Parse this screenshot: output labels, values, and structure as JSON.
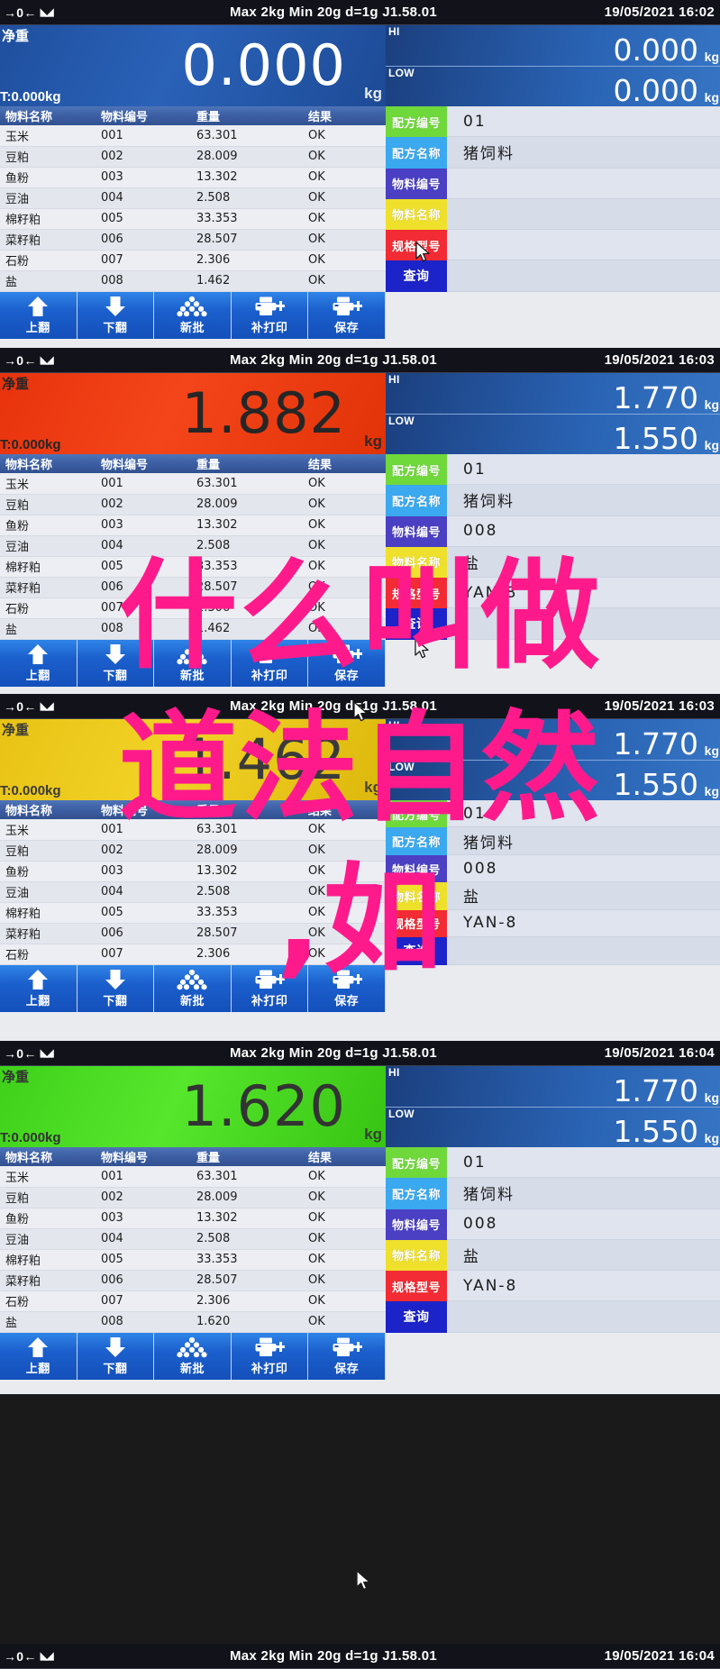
{
  "device": {
    "spec_line": "Max 2kg  Min 20g  d=1g    J1.58.01",
    "zero_icon": "→0←",
    "stable_icon": "stability-indicator",
    "net_label": "净重",
    "tare_label": "T:0.000kg",
    "unit": "kg",
    "hi_tag": "HI",
    "low_tag": "LOW"
  },
  "table": {
    "headers": {
      "name": "物料名称",
      "code": "物料编号",
      "weight": "重量",
      "result": "结果"
    }
  },
  "sidebar": {
    "tags": [
      {
        "label": "配方编号",
        "color": "#6fd83a"
      },
      {
        "label": "配方名称",
        "color": "#3ba9ef"
      },
      {
        "label": "物料编号",
        "color": "#4b3fc4"
      },
      {
        "label": "物料名称",
        "color": "#efe02c"
      },
      {
        "label": "规格型号",
        "color": "#f22b34"
      }
    ],
    "query_label": "查询"
  },
  "toolbar": {
    "buttons": [
      {
        "label": "上翻",
        "icon": "arrow-up-icon"
      },
      {
        "label": "下翻",
        "icon": "arrow-down-icon"
      },
      {
        "label": "新批",
        "icon": "pile-of-balls-icon"
      },
      {
        "label": "补打印",
        "icon": "printer-plus-icon"
      },
      {
        "label": "保存",
        "icon": "printer-save-icon"
      }
    ]
  },
  "panels": [
    {
      "id": "panel-1",
      "timestamp": "19/05/2021  16:02",
      "weight": "0.000",
      "weight_color": "blue",
      "hi": "0.000",
      "low": "0.000",
      "rows": [
        {
          "name": "玉米",
          "code": "001",
          "weight": "63.301",
          "result": "OK"
        },
        {
          "name": "豆粕",
          "code": "002",
          "weight": "28.009",
          "result": "OK"
        },
        {
          "name": "鱼粉",
          "code": "003",
          "weight": "13.302",
          "result": "OK"
        },
        {
          "name": "豆油",
          "code": "004",
          "weight": "2.508",
          "result": "OK"
        },
        {
          "name": "棉籽粕",
          "code": "005",
          "weight": "33.353",
          "result": "OK"
        },
        {
          "name": "菜籽粕",
          "code": "006",
          "weight": "28.507",
          "result": "OK"
        },
        {
          "name": "石粉",
          "code": "007",
          "weight": "2.306",
          "result": "OK"
        },
        {
          "name": "盐",
          "code": "008",
          "weight": "1.462",
          "result": "OK"
        }
      ],
      "values": [
        "01",
        "猪饲料",
        "",
        "",
        ""
      ]
    },
    {
      "id": "panel-2",
      "timestamp": "19/05/2021  16:03",
      "weight": "1.882",
      "weight_color": "red",
      "hi": "1.770",
      "low": "1.550",
      "rows": [
        {
          "name": "玉米",
          "code": "001",
          "weight": "63.301",
          "result": "OK"
        },
        {
          "name": "豆粕",
          "code": "002",
          "weight": "28.009",
          "result": "OK"
        },
        {
          "name": "鱼粉",
          "code": "003",
          "weight": "13.302",
          "result": "OK"
        },
        {
          "name": "豆油",
          "code": "004",
          "weight": "2.508",
          "result": "OK"
        },
        {
          "name": "棉籽粕",
          "code": "005",
          "weight": "33.353",
          "result": "OK"
        },
        {
          "name": "菜籽粕",
          "code": "006",
          "weight": "28.507",
          "result": "OK"
        },
        {
          "name": "石粉",
          "code": "007",
          "weight": "2.306",
          "result": "OK"
        },
        {
          "name": "盐",
          "code": "008",
          "weight": "1.462",
          "result": "OK"
        }
      ],
      "values": [
        "01",
        "猪饲料",
        "008",
        "盐",
        "YAN-8"
      ]
    },
    {
      "id": "panel-3",
      "timestamp": "19/05/2021  16:03",
      "weight": "1.462",
      "weight_color": "yellow",
      "hi": "1.770",
      "low": "1.550",
      "rows": [
        {
          "name": "玉米",
          "code": "001",
          "weight": "63.301",
          "result": "OK"
        },
        {
          "name": "豆粕",
          "code": "002",
          "weight": "28.009",
          "result": "OK"
        },
        {
          "name": "鱼粉",
          "code": "003",
          "weight": "13.302",
          "result": "OK"
        },
        {
          "name": "豆油",
          "code": "004",
          "weight": "2.508",
          "result": "OK"
        },
        {
          "name": "棉籽粕",
          "code": "005",
          "weight": "33.353",
          "result": "OK"
        },
        {
          "name": "菜籽粕",
          "code": "006",
          "weight": "28.507",
          "result": "OK"
        },
        {
          "name": "石粉",
          "code": "007",
          "weight": "2.306",
          "result": "OK"
        }
      ],
      "values": [
        "01",
        "猪饲料",
        "008",
        "盐",
        "YAN-8"
      ]
    },
    {
      "id": "panel-4",
      "timestamp": "19/05/2021  16:04",
      "weight": "1.620",
      "weight_color": "green",
      "hi": "1.770",
      "low": "1.550",
      "rows": [
        {
          "name": "玉米",
          "code": "001",
          "weight": "63.301",
          "result": "OK"
        },
        {
          "name": "豆粕",
          "code": "002",
          "weight": "28.009",
          "result": "OK"
        },
        {
          "name": "鱼粉",
          "code": "003",
          "weight": "13.302",
          "result": "OK"
        },
        {
          "name": "豆油",
          "code": "004",
          "weight": "2.508",
          "result": "OK"
        },
        {
          "name": "棉籽粕",
          "code": "005",
          "weight": "33.353",
          "result": "OK"
        },
        {
          "name": "菜籽粕",
          "code": "006",
          "weight": "28.507",
          "result": "OK"
        },
        {
          "name": "石粉",
          "code": "007",
          "weight": "2.306",
          "result": "OK"
        },
        {
          "name": "盐",
          "code": "008",
          "weight": "1.620",
          "result": "OK"
        }
      ],
      "values": [
        "01",
        "猪饲料",
        "008",
        "盐",
        "YAN-8"
      ]
    }
  ],
  "bottom_strip": {
    "timestamp": "19/05/2021  16:04",
    "spec_line": "Max 2kg  Min 20g  d=1g    J1.58.01"
  },
  "watermark": {
    "color": "#ff1a8c",
    "lines": [
      "什么叫做",
      "道法自然",
      ",如"
    ]
  }
}
